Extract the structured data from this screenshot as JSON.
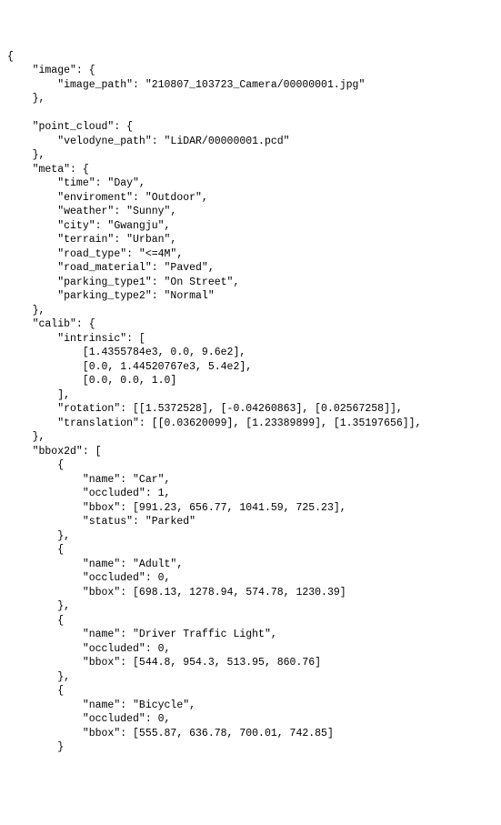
{
  "lines": [
    "{",
    "    \"image\": {",
    "        \"image_path\": \"210807_103723_Camera/00000001.jpg\"",
    "    },",
    "",
    "    \"point_cloud\": {",
    "        \"velodyne_path\": \"LiDAR/00000001.pcd\"",
    "    },",
    "    \"meta\": {",
    "        \"time\": \"Day\",",
    "        \"enviroment\": \"Outdoor\",",
    "        \"weather\": \"Sunny\",",
    "        \"city\": \"Gwangju\",",
    "        \"terrain\": \"Urban\",",
    "        \"road_type\": \"<=4M\",",
    "        \"road_material\": \"Paved\",",
    "        \"parking_type1\": \"On Street\",",
    "        \"parking_type2\": \"Normal\"",
    "    },",
    "    \"calib\": {",
    "        \"intrinsic\": [",
    "            [1.4355784e3, 0.0, 9.6e2],",
    "            [0.0, 1.44520767e3, 5.4e2],",
    "            [0.0, 0.0, 1.0]",
    "        ],",
    "        \"rotation\": [[1.5372528], [-0.04260863], [0.02567258]],",
    "        \"translation\": [[0.03620099], [1.23389899], [1.35197656]],",
    "    },",
    "    \"bbox2d\": [",
    "        {",
    "            \"name\": \"Car\",",
    "            \"occluded\": 1,",
    "            \"bbox\": [991.23, 656.77, 1041.59, 725.23],",
    "            \"status\": \"Parked\"",
    "        },",
    "        {",
    "            \"name\": \"Adult\",",
    "            \"occluded\": 0,",
    "            \"bbox\": [698.13, 1278.94, 574.78, 1230.39]",
    "        },",
    "        {",
    "            \"name\": \"Driver Traffic Light\",",
    "            \"occluded\": 0,",
    "            \"bbox\": [544.8, 954.3, 513.95, 860.76]",
    "        },",
    "        {",
    "            \"name\": \"Bicycle\",",
    "            \"occluded\": 0,",
    "            \"bbox\": [555.87, 636.78, 700.01, 742.85]",
    "        }"
  ]
}
